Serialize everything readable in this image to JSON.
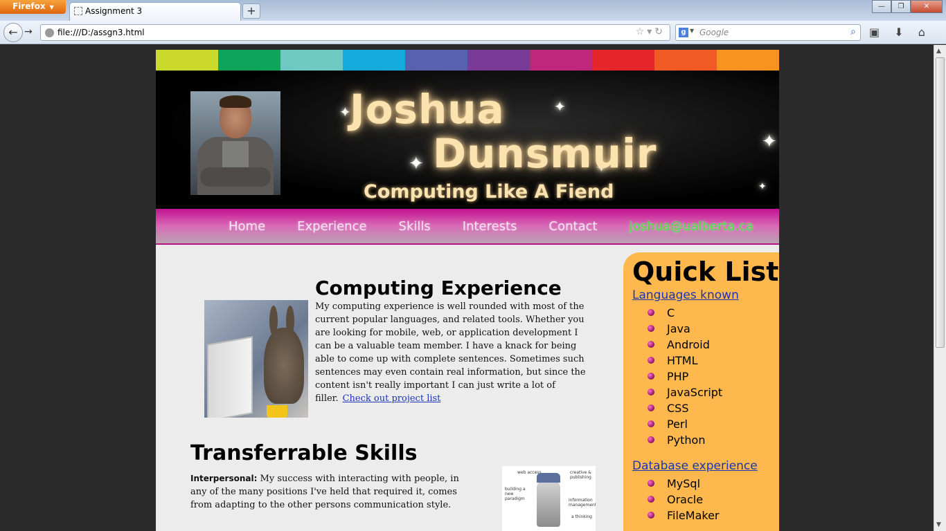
{
  "browser": {
    "menu_button": "Firefox",
    "tab_title": "Assignment 3",
    "new_tab": "+",
    "url": "file:///D:/assgn3.html",
    "search_placeholder": "Google",
    "search_engine_letter": "g"
  },
  "colorbar": [
    "#cbd92b",
    "#0ea55a",
    "#6fc9c3",
    "#16a9dc",
    "#5861b0",
    "#7a3a98",
    "#c0267a",
    "#e6252a",
    "#f05a24",
    "#f7931e"
  ],
  "header": {
    "first_name": "Joshua",
    "last_name": "Dunsmuir",
    "tagline": "Computing Like A Fiend"
  },
  "nav": {
    "items": [
      "Home",
      "Experience",
      "Skills",
      "Interests",
      "Contact"
    ],
    "email": "joshua@ualberta.ca"
  },
  "experience": {
    "heading": "Computing Experience",
    "body": "My computing experience is well rounded with most of the current popular languages, and related tools. Whether you are looking for mobile, web, or application development I can be a valuable team member. I have a knack for being able to come up with complete sentences. Sometimes such sentences may even contain real information, but since the content isn't really important I can just write a lot of filler.",
    "link": "Check out project list"
  },
  "skills": {
    "heading": "Transferrable Skills",
    "label": "Interpersonal:",
    "body": "My success with interacting with people, in any of the many positions I've held that required it, comes from adapting to the other persons communication style."
  },
  "gadget_labels": {
    "web": "web access",
    "creative": "creative & publishing",
    "building": "building a new paradigm",
    "info": "information management",
    "thinking": "a thinking"
  },
  "quick_list": {
    "title": "Quick List",
    "languages_label": "Languages known",
    "languages": [
      "C",
      "Java",
      "Android",
      "HTML",
      "PHP",
      "JavaScript",
      "CSS",
      "Perl",
      "Python"
    ],
    "database_label": "Database experience",
    "databases": [
      "MySql",
      "Oracle",
      "FileMaker"
    ]
  }
}
